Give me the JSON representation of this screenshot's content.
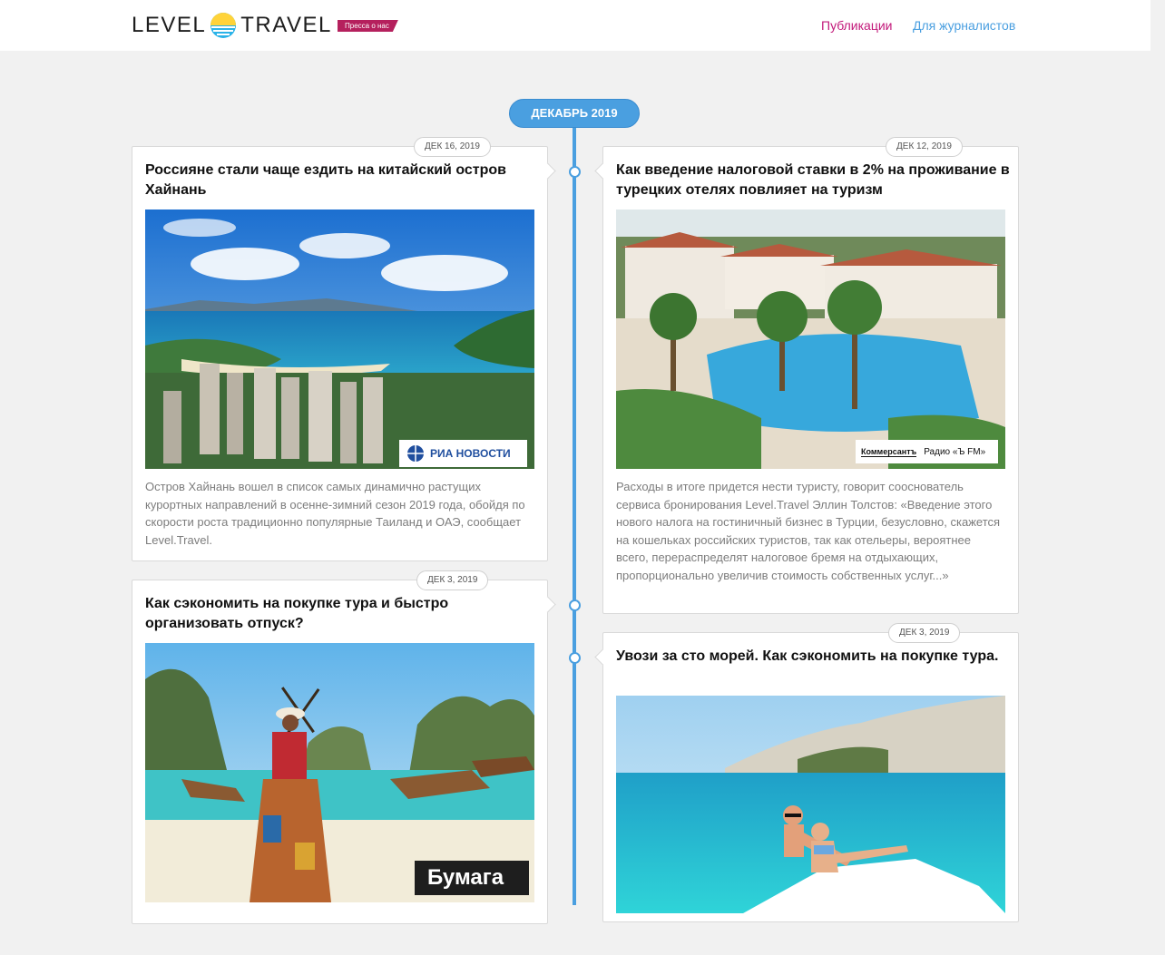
{
  "header": {
    "logo_left": "LEVEL",
    "logo_right": "TRAVEL",
    "press_badge": "Пресса о нас",
    "nav": [
      {
        "label": "Публикации",
        "color": "#c2187a"
      },
      {
        "label": "Для журналистов",
        "color": "#4a9fe0"
      }
    ]
  },
  "timeline": {
    "month": "ДЕКАБРЬ 2019",
    "accent": "#4a9fe0"
  },
  "articles": [
    {
      "date": "ДЕК 16, 2019",
      "title": "Россияне стали чаще ездить на китайский остров Хайнань",
      "source": "РИА НОВОСТИ",
      "text": "Остров Хайнань вошел в список самых динамично растущих курортных направлений в осенне-зимний сезон 2019 года, обойдя по скорости роста традиционно популярные Таиланд и ОАЭ, сообщает Level.Travel."
    },
    {
      "date": "ДЕК 12, 2019",
      "title": "Как введение налоговой ставки в 2% на проживание в турецких отелях повлияет на туризм",
      "source": "Коммерсантъ",
      "source_extra": "Радио «Ъ FM»",
      "text": "Расходы в итоге придется нести туристу, говорит сооснователь сервиса бронирования Level.Travel Эллин Толстов: «Введение этого нового налога на гостиничный бизнес в Турции, безусловно, скажется на кошельках российских туристов, так как отельеры, вероятнее всего, перераспределят налоговое бремя на отдыхающих, пропорционально увеличив стоимость собственных услуг...»"
    },
    {
      "date": "ДЕК 3, 2019",
      "title": "Как сэкономить на покупке тура и быстро организовать отпуск?",
      "source": "Бумага"
    },
    {
      "date": "ДЕК 3, 2019",
      "title": "Увози за сто морей. Как сэкономить на покупке тура."
    }
  ]
}
